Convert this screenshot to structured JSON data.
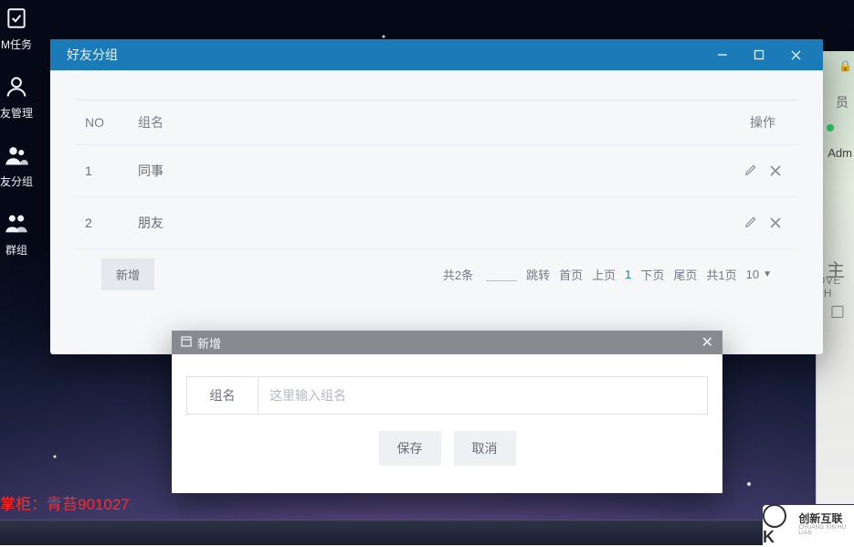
{
  "sidebar": {
    "items": [
      {
        "label": "M任务",
        "icon": "check-file-icon"
      },
      {
        "label": "友管理",
        "icon": "user-icon"
      },
      {
        "label": "友分组",
        "icon": "users-icon"
      },
      {
        "label": "群组",
        "icon": "group-icon"
      }
    ]
  },
  "modal": {
    "title": "好友分组",
    "table": {
      "headers": {
        "no": "NO",
        "name": "组名",
        "op": "操作"
      },
      "rows": [
        {
          "no": "1",
          "name": "同事"
        },
        {
          "no": "2",
          "name": "朋友"
        }
      ]
    },
    "add_button": "新增",
    "pager": {
      "total_text": "共2条",
      "jump_text": "跳转",
      "first": "首页",
      "prev": "上页",
      "current": "1",
      "next": "下页",
      "last": "尾页",
      "pages_text": "共1页",
      "page_size": "10"
    }
  },
  "sub_dialog": {
    "title": "新增",
    "field_label": "组名",
    "placeholder": "这里输入组名",
    "save": "保存",
    "cancel": "取消"
  },
  "right_panel": {
    "chip": "员",
    "name": "Adm",
    "glyph": "主",
    "love": "OVE FH",
    "box": "☐"
  },
  "footer_text": "掌柜：青苔901027",
  "watermark": {
    "brand": "创新互联",
    "sub": "CHUANG XIN HU LIAN"
  }
}
